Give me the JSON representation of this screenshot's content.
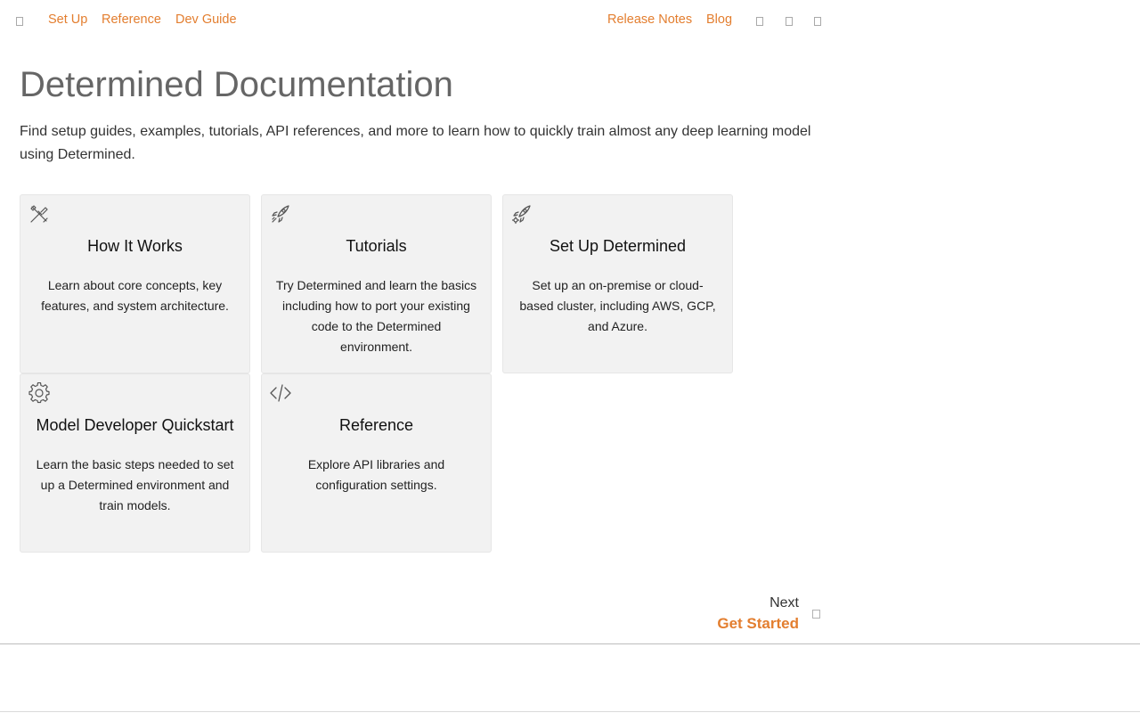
{
  "nav": {
    "left_links": [
      "Set Up",
      "Reference",
      "Dev Guide"
    ],
    "right_links": [
      "Release Notes",
      "Blog"
    ],
    "icons": [
      "menu-icon",
      "search-icon",
      "theme-toggle-icon",
      "github-icon"
    ]
  },
  "page": {
    "title": "Determined Documentation",
    "intro": "Find setup guides, examples, tutorials, API references, and more to learn how to quickly train almost any deep learning model using Determined."
  },
  "cards": [
    {
      "icon": "tools-icon",
      "title": "How It Works",
      "description": "Learn about core concepts, key features, and system architecture."
    },
    {
      "icon": "rocket-icon",
      "title": "Tutorials",
      "description": "Try Determined and learn the basics including how to port your existing code to the Determined environment."
    },
    {
      "icon": "setup-rocket-icon",
      "title": "Set Up Determined",
      "description": "Set up an on-premise or cloud-based cluster, including AWS, GCP, and Azure."
    },
    {
      "icon": "gear-icon",
      "title": "Model Developer Quickstart",
      "description": "Learn the basic steps needed to set up a Determined environment and train models."
    },
    {
      "icon": "code-icon",
      "title": "Reference",
      "description": "Explore API libraries and configuration settings."
    }
  ],
  "pagination": {
    "next_label": "Next",
    "next_link": "Get Started",
    "next_icon": "chevron-right-icon"
  },
  "colors": {
    "accent": "#e37e2f",
    "card_bg": "#f2f2f2",
    "title": "#666666",
    "text": "#333333"
  }
}
